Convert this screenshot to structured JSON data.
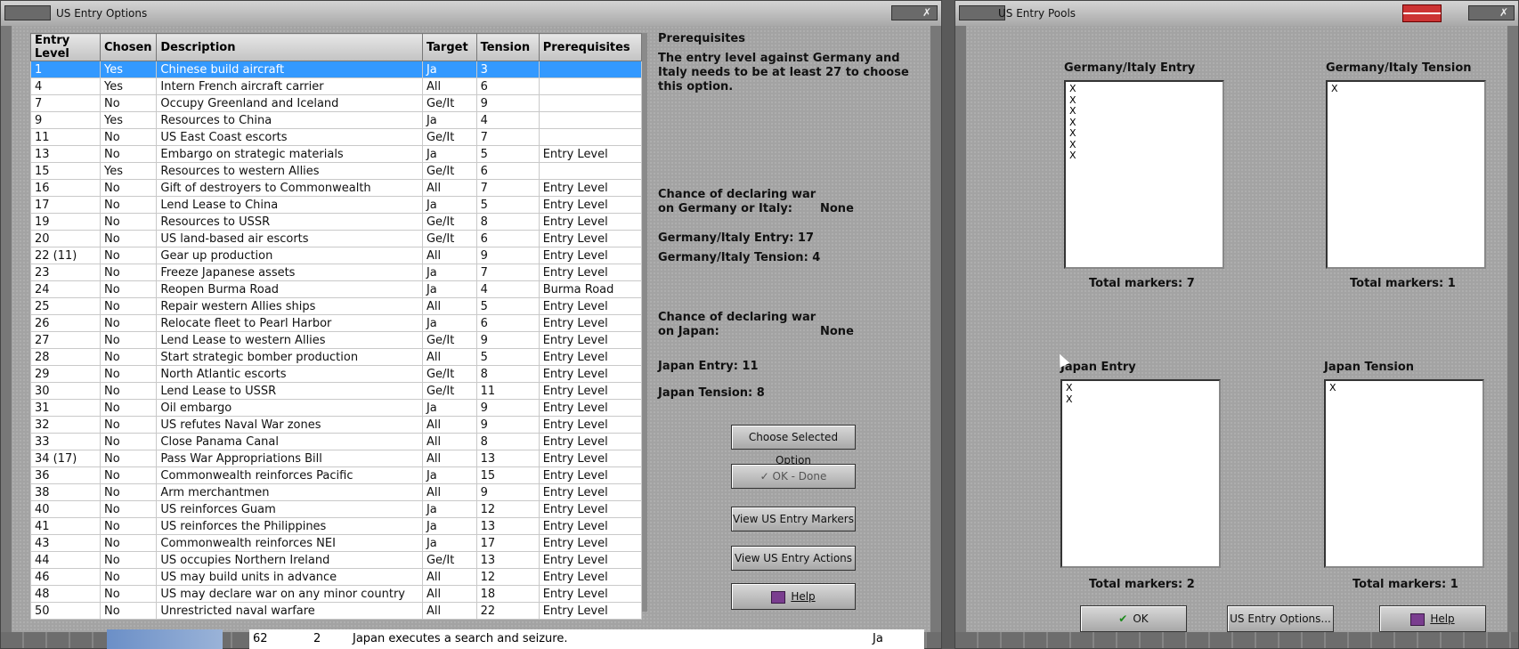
{
  "left_window": {
    "title": "US Entry Options",
    "close_label": "✗",
    "table": {
      "headers": [
        "Entry Level",
        "Chosen",
        "Description",
        "Target",
        "Tension",
        "Prerequisites"
      ],
      "rows": [
        [
          "1",
          "Yes",
          "Chinese build aircraft",
          "Ja",
          "3",
          ""
        ],
        [
          "4",
          "Yes",
          "Intern French aircraft carrier",
          "All",
          "6",
          ""
        ],
        [
          "7",
          "No",
          "Occupy Greenland and Iceland",
          "Ge/It",
          "9",
          ""
        ],
        [
          "9",
          "Yes",
          "Resources to China",
          "Ja",
          "4",
          ""
        ],
        [
          "11",
          "No",
          "US East Coast escorts",
          "Ge/It",
          "7",
          ""
        ],
        [
          "13",
          "No",
          "Embargo on strategic materials",
          "Ja",
          "5",
          "Entry Level"
        ],
        [
          "15",
          "Yes",
          "Resources to western Allies",
          "Ge/It",
          "6",
          ""
        ],
        [
          "16",
          "No",
          "Gift of destroyers to Commonwealth",
          "All",
          "7",
          "Entry Level"
        ],
        [
          "17",
          "No",
          "Lend Lease to China",
          "Ja",
          "5",
          "Entry Level"
        ],
        [
          "19",
          "No",
          "Resources to USSR",
          "Ge/It",
          "8",
          "Entry Level"
        ],
        [
          "20",
          "No",
          "US land-based air escorts",
          "Ge/It",
          "6",
          "Entry Level"
        ],
        [
          "22 (11)",
          "No",
          "Gear up production",
          "All",
          "9",
          "Entry Level"
        ],
        [
          "23",
          "No",
          "Freeze Japanese assets",
          "Ja",
          "7",
          "Entry Level"
        ],
        [
          "24",
          "No",
          "Reopen Burma Road",
          "Ja",
          "4",
          "Burma Road"
        ],
        [
          "25",
          "No",
          "Repair western Allies ships",
          "All",
          "5",
          "Entry Level"
        ],
        [
          "26",
          "No",
          "Relocate fleet to Pearl Harbor",
          "Ja",
          "6",
          "Entry Level"
        ],
        [
          "27",
          "No",
          "Lend Lease to western Allies",
          "Ge/It",
          "9",
          "Entry Level"
        ],
        [
          "28",
          "No",
          "Start strategic bomber production",
          "All",
          "5",
          "Entry Level"
        ],
        [
          "29",
          "No",
          "North Atlantic escorts",
          "Ge/It",
          "8",
          "Entry Level"
        ],
        [
          "30",
          "No",
          "Lend Lease to USSR",
          "Ge/It",
          "11",
          "Entry Level"
        ],
        [
          "31",
          "No",
          "Oil embargo",
          "Ja",
          "9",
          "Entry Level"
        ],
        [
          "32",
          "No",
          "US refutes Naval War zones",
          "All",
          "9",
          "Entry Level"
        ],
        [
          "33",
          "No",
          "Close Panama Canal",
          "All",
          "8",
          "Entry Level"
        ],
        [
          "34 (17)",
          "No",
          "Pass War Appropriations Bill",
          "All",
          "13",
          "Entry Level"
        ],
        [
          "36",
          "No",
          "Commonwealth reinforces Pacific",
          "Ja",
          "15",
          "Entry Level"
        ],
        [
          "38",
          "No",
          "Arm merchantmen",
          "All",
          "9",
          "Entry Level"
        ],
        [
          "40",
          "No",
          "US reinforces Guam",
          "Ja",
          "12",
          "Entry Level"
        ],
        [
          "41",
          "No",
          "US reinforces the Philippines",
          "Ja",
          "13",
          "Entry Level"
        ],
        [
          "43",
          "No",
          "Commonwealth reinforces NEI",
          "Ja",
          "17",
          "Entry Level"
        ],
        [
          "44",
          "No",
          "US occupies Northern Ireland",
          "Ge/It",
          "13",
          "Entry Level"
        ],
        [
          "46",
          "No",
          "US may build units in advance",
          "All",
          "12",
          "Entry Level"
        ],
        [
          "48",
          "No",
          "US may declare war on any minor country",
          "All",
          "18",
          "Entry Level"
        ],
        [
          "50",
          "No",
          "Unrestricted naval warfare",
          "All",
          "22",
          "Entry Level"
        ]
      ]
    },
    "info": {
      "prereq_title": "Prerequisites",
      "prereq_text": "The entry level against Germany and Italy needs to be at least 27 to choose this option.",
      "chance_gi_line1": "Chance of declaring war",
      "chance_gi_line2": "on Germany or Italy:",
      "chance_gi_value": "None",
      "gi_entry": "Germany/Italy Entry: 17",
      "gi_tension": "Germany/Italy Tension: 4",
      "chance_ja_line1": "Chance of declaring war",
      "chance_ja_line2": "on Japan:",
      "chance_ja_value": "None",
      "ja_entry": "Japan Entry: 11",
      "ja_tension": "Japan Tension: 8"
    },
    "buttons": {
      "choose": "Choose Selected Option",
      "ok_done": "✓ OK - Done",
      "view_markers": "View US Entry Markers",
      "view_actions": "View US Entry Actions",
      "help": "Help"
    }
  },
  "right_window": {
    "title": "US Entry Pools",
    "close_label": "✗",
    "pools": [
      {
        "label": "Germany/Italy Entry",
        "markers": "X\nX\nX\nX\nX\nX\nX",
        "total": "Total markers: 7"
      },
      {
        "label": "Germany/Italy Tension",
        "markers": "X",
        "total": "Total markers: 1"
      },
      {
        "label": "Japan Entry",
        "markers": "X\nX",
        "total": "Total markers: 2"
      },
      {
        "label": "Japan Tension",
        "markers": "X",
        "total": "Total markers: 1"
      }
    ],
    "buttons": {
      "ok": "OK",
      "options": "US Entry Options...",
      "help": "Help"
    }
  },
  "background_row": {
    "num": "62",
    "count": "2",
    "text": "Japan executes a search and seizure.",
    "target": "Ja"
  }
}
